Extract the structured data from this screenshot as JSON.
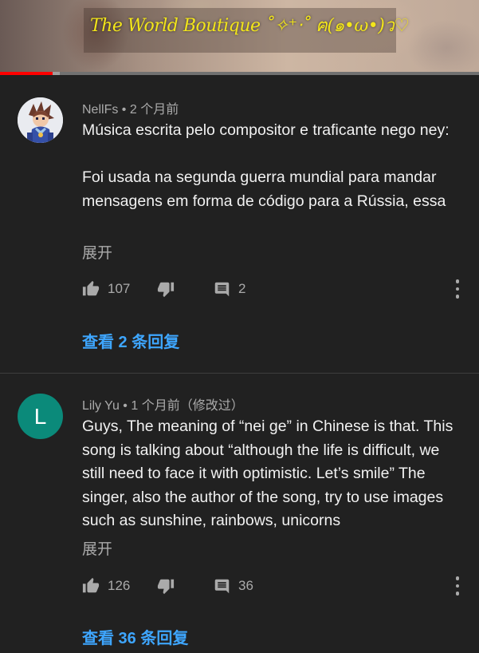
{
  "video": {
    "title": "The World Boutique ˚✧⁺‧˚ ฅ(๑•ω•)ว♡",
    "progress_percent": 11,
    "buffer_percent": 1.5
  },
  "comments": [
    {
      "author": "NellFs",
      "time": "2 个月前",
      "body": "Música escrita pelo compositor e traficante nego ney:\n\nFoi usada na segunda guerra mundial para mandar mensagens em forma de código para a Rússia, essa",
      "expand": "展开",
      "likes": "107",
      "replies_count": "2",
      "view_replies": "查看 2 条回复"
    },
    {
      "author": "Lily Yu",
      "avatar_letter": "L",
      "time": "1 个月前（修改过）",
      "body": "Guys, The meaning of “nei ge” in Chinese is that. This song is talking about “although the life is difficult, we still need to face it with optimistic. Let’s smile” The singer, also the author of the song, try to use images such as sunshine, rainbows, unicorns",
      "expand": "展开",
      "likes": "126",
      "replies_count": "36",
      "view_replies": "查看 36 条回复"
    }
  ],
  "separator": " • ",
  "colors": {
    "background": "#212121",
    "link": "#3ea6ff",
    "progress": "#ff0000",
    "avatar_l": "#0b8a7a"
  },
  "icons": [
    "thumb-up-icon",
    "thumb-down-icon",
    "comment-icon",
    "more-vert-icon"
  ]
}
